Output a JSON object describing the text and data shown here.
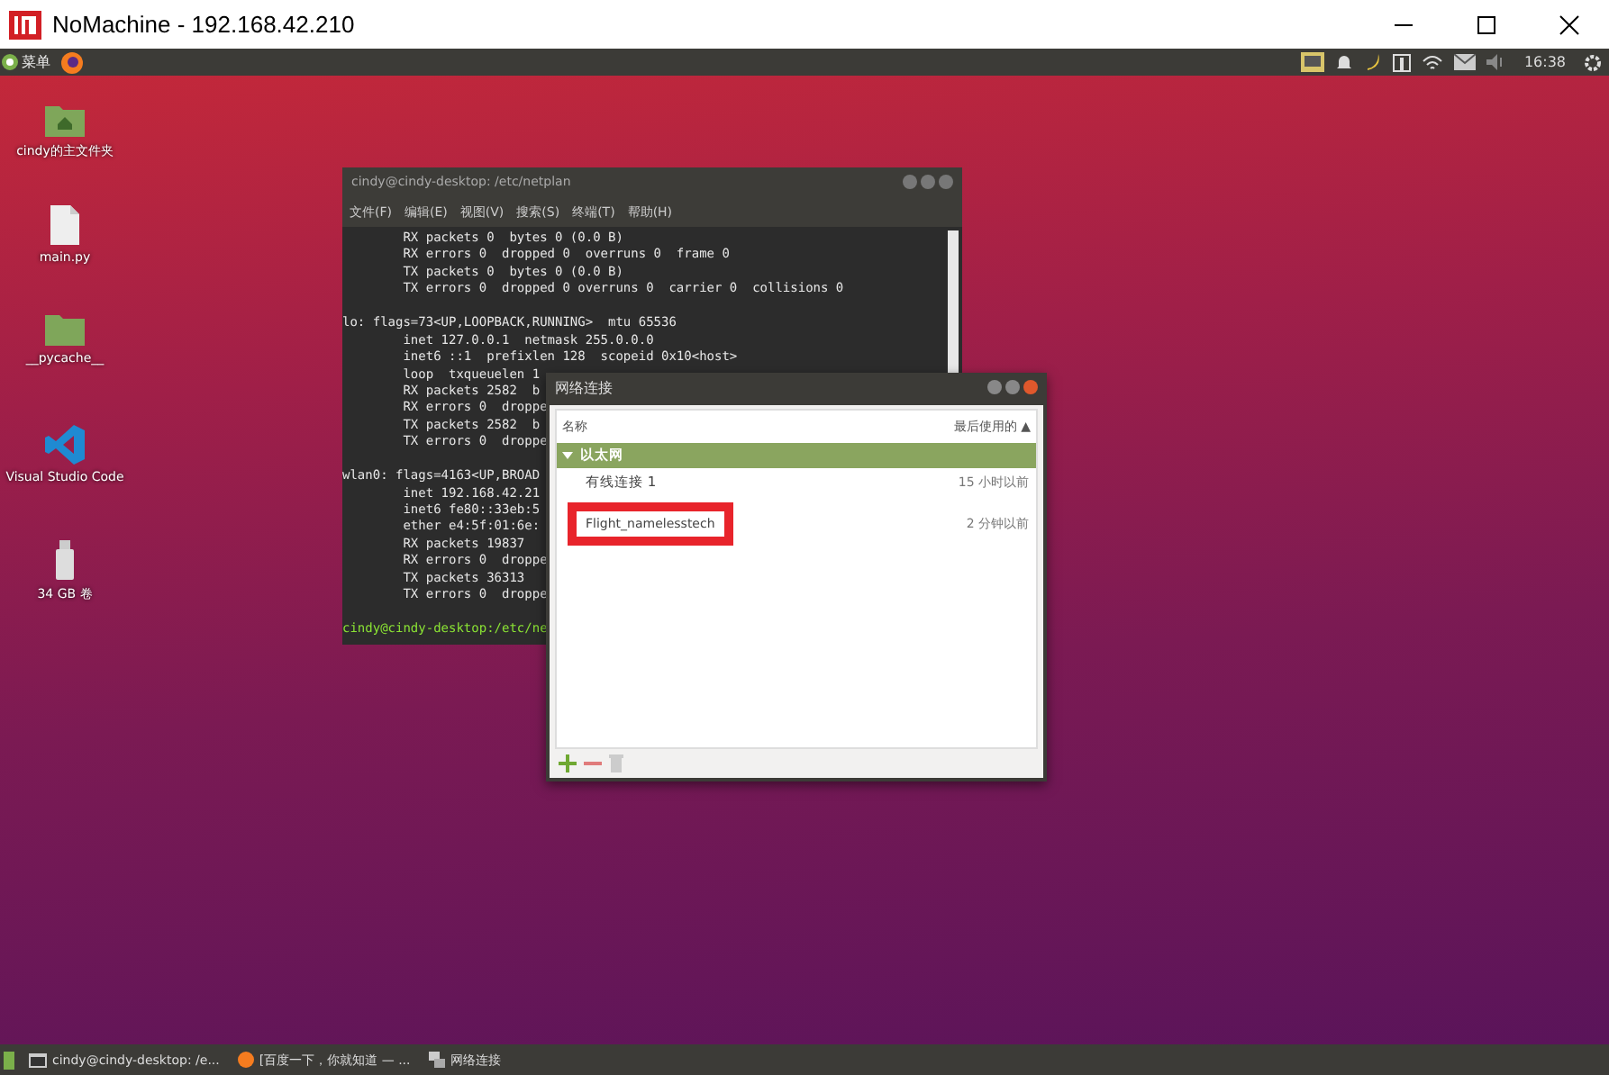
{
  "window": {
    "title": "NoMachine - 192.168.42.210"
  },
  "top_panel": {
    "menu": "菜单",
    "clock": "16:38"
  },
  "desktop_icons": [
    {
      "kind": "home-folder",
      "label": "cindy的主文件夹"
    },
    {
      "kind": "file",
      "label": "main.py"
    },
    {
      "kind": "folder",
      "label": "__pycache__"
    },
    {
      "kind": "vscode",
      "label": "Visual Studio Code"
    },
    {
      "kind": "drive",
      "label": "34 GB 卷"
    }
  ],
  "terminal": {
    "title": "cindy@cindy-desktop: /etc/netplan",
    "menu": [
      "文件(F)",
      "编辑(E)",
      "视图(V)",
      "搜索(S)",
      "终端(T)",
      "帮助(H)"
    ],
    "blocks": [
      [
        "        RX packets 0  bytes 0 (0.0 B)",
        "        RX errors 0  dropped 0  overruns 0  frame 0",
        "        TX packets 0  bytes 0 (0.0 B)",
        "        TX errors 0  dropped 0 overruns 0  carrier 0  collisions 0"
      ],
      [
        "lo: flags=73<UP,LOOPBACK,RUNNING>  mtu 65536",
        "        inet 127.0.0.1  netmask 255.0.0.0",
        "        inet6 ::1  prefixlen 128  scopeid 0x10<host>",
        "        loop  txqueuelen 1",
        "        RX packets 2582  b",
        "        RX errors 0  droppe",
        "        TX packets 2582  b",
        "        TX errors 0  droppe"
      ],
      [
        "wlan0: flags=4163<UP,BROAD",
        "        inet 192.168.42.21",
        "        inet6 fe80::33eb:5",
        "        ether e4:5f:01:6e:",
        "        RX packets 19837",
        "        RX errors 0  droppe",
        "        TX packets 36313",
        "        TX errors 0  droppe"
      ]
    ],
    "prompt": "cindy@cindy-desktop:/etc/ne"
  },
  "network_dialog": {
    "title": "网络连接",
    "columns": [
      "名称",
      "最后使用的"
    ],
    "sort_indicator": "▲",
    "rows": [
      {
        "kind": "group",
        "label": "以太网",
        "expanded": true
      },
      {
        "kind": "connection",
        "label": "有线连接 1",
        "last_used": "15 小时以前"
      },
      {
        "kind": "annotated",
        "label": "Flight_namelesstech",
        "last_used": "2 分钟以前"
      }
    ]
  },
  "taskbar": [
    {
      "kind": "terminal",
      "label": "cindy@cindy-desktop: /e..."
    },
    {
      "kind": "browser",
      "label": "[百度一下，你就知道 — ..."
    },
    {
      "kind": "network",
      "label": "网络连接"
    }
  ]
}
